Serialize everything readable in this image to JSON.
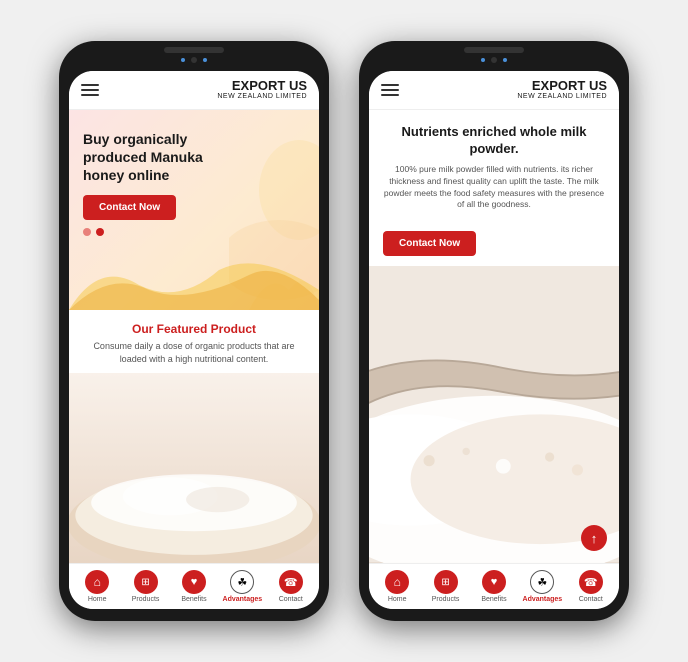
{
  "app": {
    "logo_main": "EXPORT US",
    "logo_sub": "NEW ZEALAND LIMITED",
    "hamburger_aria": "menu"
  },
  "phone1": {
    "hero": {
      "title": "Buy organically produced Manuka honey online",
      "contact_btn": "Contact Now",
      "dot1_state": "inactive",
      "dot2_state": "active"
    },
    "featured": {
      "title": "Our Featured Product",
      "description": "Consume daily a dose of organic products that are loaded with a high nutritional content."
    },
    "nav": {
      "items": [
        {
          "label": "Home",
          "icon": "home",
          "active": false
        },
        {
          "label": "Products",
          "icon": "grid",
          "active": false
        },
        {
          "label": "Benefits",
          "icon": "heart",
          "active": false
        },
        {
          "label": "Advantages",
          "icon": "leaf",
          "active": true
        },
        {
          "label": "Contact",
          "icon": "phone",
          "active": false
        }
      ]
    }
  },
  "phone2": {
    "hero": {
      "title": "Nutrients enriched whole milk powder.",
      "description": "100% pure milk powder filled with nutrients. its richer thickness and finest quality can uplift the taste. The milk powder meets the food safety measures with the presence of all the goodness.",
      "contact_btn": "Contact Now"
    },
    "nav": {
      "items": [
        {
          "label": "Home",
          "icon": "home",
          "active": false
        },
        {
          "label": "Products",
          "icon": "grid",
          "active": false
        },
        {
          "label": "Benefits",
          "icon": "heart",
          "active": false
        },
        {
          "label": "Advantages",
          "icon": "leaf",
          "active": true
        },
        {
          "label": "Contact",
          "icon": "phone",
          "active": false
        }
      ]
    }
  },
  "icons": {
    "home": "⌂",
    "grid": "⊞",
    "heart": "♥",
    "leaf": "❧",
    "phone": "☎",
    "arrow_up": "↑",
    "hamburger": "☰"
  }
}
